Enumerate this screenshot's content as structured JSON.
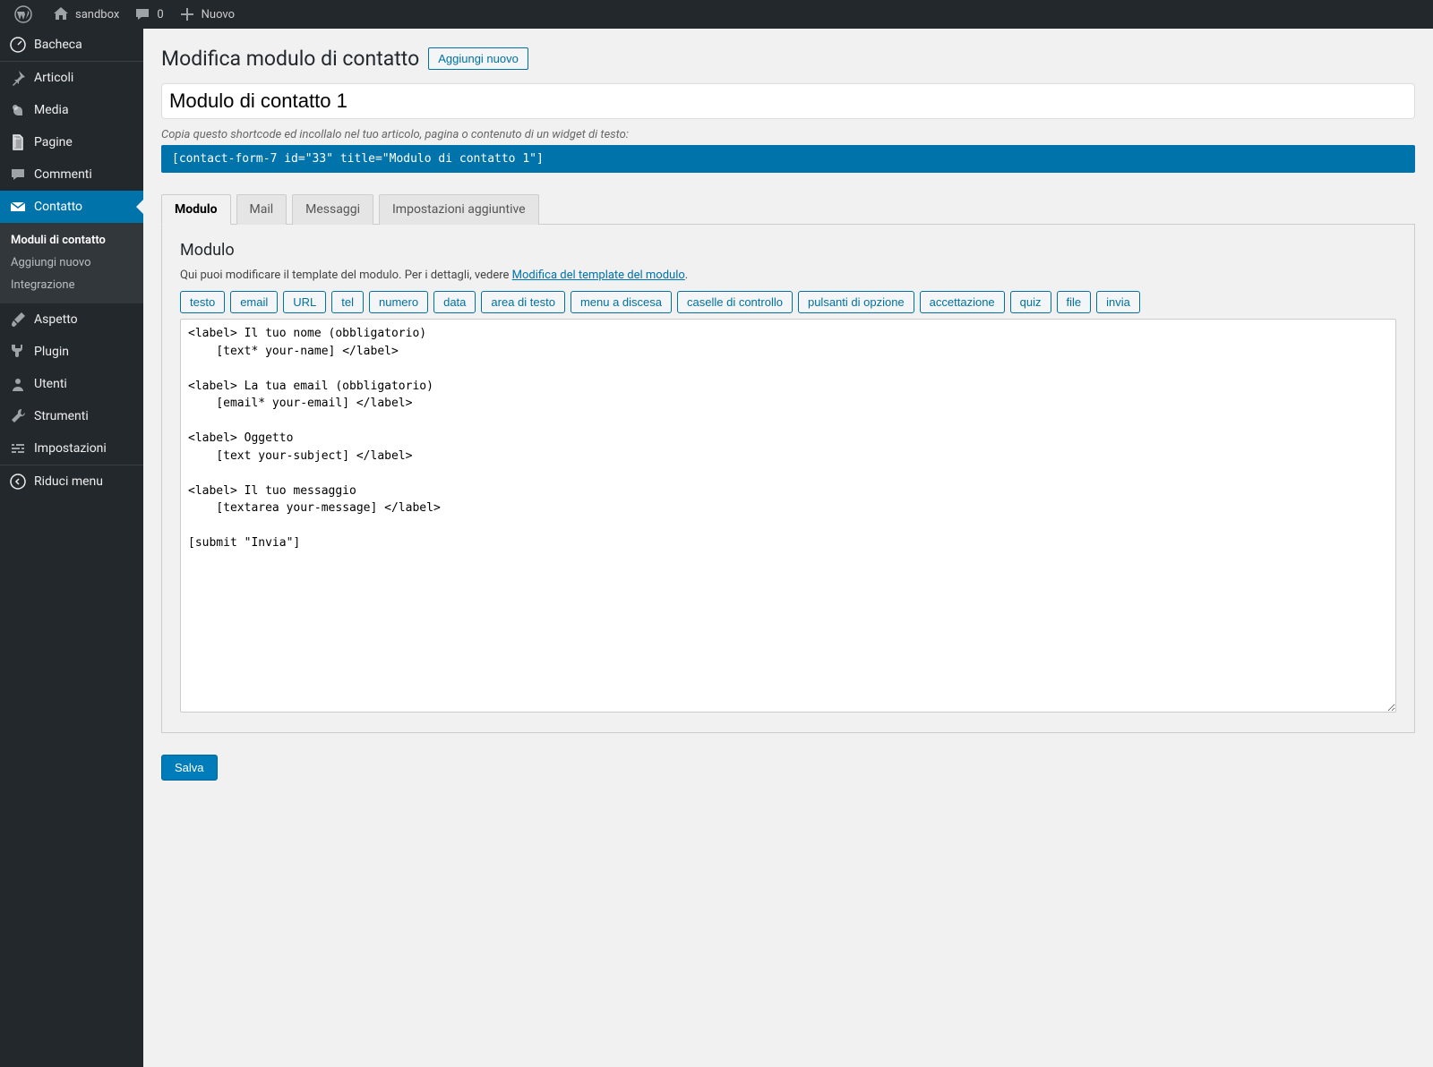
{
  "topbar": {
    "site_name": "sandbox",
    "comments_count": "0",
    "new_label": "Nuovo"
  },
  "sidebar": {
    "items": [
      {
        "label": "Bacheca"
      },
      {
        "label": "Articoli"
      },
      {
        "label": "Media"
      },
      {
        "label": "Pagine"
      },
      {
        "label": "Commenti"
      },
      {
        "label": "Contatto"
      },
      {
        "label": "Aspetto"
      },
      {
        "label": "Plugin"
      },
      {
        "label": "Utenti"
      },
      {
        "label": "Strumenti"
      },
      {
        "label": "Impostazioni"
      },
      {
        "label": "Riduci menu"
      }
    ],
    "submenu": [
      {
        "label": "Moduli di contatto"
      },
      {
        "label": "Aggiungi nuovo"
      },
      {
        "label": "Integrazione"
      }
    ]
  },
  "page": {
    "title": "Modifica modulo di contatto",
    "add_new": "Aggiungi nuovo",
    "form_title": "Modulo di contatto 1",
    "shortcode_desc": "Copia questo shortcode ed incollalo nel tuo articolo, pagina o contenuto di un widget di testo:",
    "shortcode": "[contact-form-7 id=\"33\" title=\"Modulo di contatto 1\"]"
  },
  "tabs": [
    {
      "label": "Modulo"
    },
    {
      "label": "Mail"
    },
    {
      "label": "Messaggi"
    },
    {
      "label": "Impostazioni aggiuntive"
    }
  ],
  "panel": {
    "heading": "Modulo",
    "desc_pre": "Qui puoi modificare il template del modulo. Per i dettagli, vedere ",
    "desc_link": "Modifica del template del modulo",
    "desc_post": ".",
    "tags": [
      "testo",
      "email",
      "URL",
      "tel",
      "numero",
      "data",
      "area di testo",
      "menu a discesa",
      "caselle di controllo",
      "pulsanti di opzione",
      "accettazione",
      "quiz",
      "file",
      "invia"
    ],
    "textarea": "<label> Il tuo nome (obbligatorio)\n    [text* your-name] </label>\n\n<label> La tua email (obbligatorio)\n    [email* your-email] </label>\n\n<label> Oggetto\n    [text your-subject] </label>\n\n<label> Il tuo messaggio\n    [textarea your-message] </label>\n\n[submit \"Invia\"]"
  },
  "save_label": "Salva"
}
